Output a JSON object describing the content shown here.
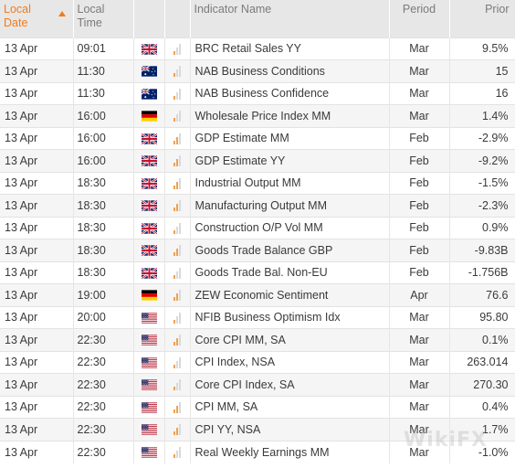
{
  "header": {
    "local_date": "Local Date",
    "local_time": "Local Time",
    "indicator_name": "Indicator Name",
    "period": "Period",
    "prior": "Prior"
  },
  "colors": {
    "accent": "#f07c1c",
    "importance": "#f0a050"
  },
  "rows": [
    {
      "date": "13 Apr",
      "time": "09:01",
      "approx": "",
      "flag": "uk-flag-icon",
      "importance": 1,
      "name": "BRC Retail Sales YY",
      "period": "Mar",
      "prior": "9.5%"
    },
    {
      "date": "13 Apr",
      "time": "11:30",
      "approx": "",
      "flag": "australia-flag-icon",
      "importance": 1,
      "name": "NAB Business Conditions",
      "period": "Mar",
      "prior": "15"
    },
    {
      "date": "13 Apr",
      "time": "11:30",
      "approx": "",
      "flag": "australia-flag-icon",
      "importance": 1,
      "name": "NAB Business Confidence",
      "period": "Mar",
      "prior": "16"
    },
    {
      "date": "13 Apr",
      "time": "16:00",
      "approx": "≈",
      "flag": "germany-flag-icon",
      "importance": 1,
      "name": "Wholesale Price Index MM",
      "period": "Mar",
      "prior": "1.4%"
    },
    {
      "date": "13 Apr",
      "time": "16:00",
      "approx": "",
      "flag": "uk-flag-icon",
      "importance": 2,
      "name": "GDP Estimate MM",
      "period": "Feb",
      "prior": "-2.9%"
    },
    {
      "date": "13 Apr",
      "time": "16:00",
      "approx": "",
      "flag": "uk-flag-icon",
      "importance": 2,
      "name": "GDP Estimate YY",
      "period": "Feb",
      "prior": "-9.2%"
    },
    {
      "date": "13 Apr",
      "time": "18:30",
      "approx": "",
      "flag": "uk-flag-icon",
      "importance": 2,
      "name": "Industrial Output MM",
      "period": "Feb",
      "prior": "-1.5%"
    },
    {
      "date": "13 Apr",
      "time": "18:30",
      "approx": "",
      "flag": "uk-flag-icon",
      "importance": 2,
      "name": "Manufacturing Output MM",
      "period": "Feb",
      "prior": "-2.3%"
    },
    {
      "date": "13 Apr",
      "time": "18:30",
      "approx": "",
      "flag": "uk-flag-icon",
      "importance": 1,
      "name": "Construction O/P Vol MM",
      "period": "Feb",
      "prior": "0.9%"
    },
    {
      "date": "13 Apr",
      "time": "18:30",
      "approx": "",
      "flag": "uk-flag-icon",
      "importance": 2,
      "name": "Goods Trade Balance GBP",
      "period": "Feb",
      "prior": "-9.83B"
    },
    {
      "date": "13 Apr",
      "time": "18:30",
      "approx": "",
      "flag": "uk-flag-icon",
      "importance": 1,
      "name": "Goods Trade Bal. Non-EU",
      "period": "Feb",
      "prior": "-1.756B"
    },
    {
      "date": "13 Apr",
      "time": "19:00",
      "approx": "",
      "flag": "germany-flag-icon",
      "importance": 2,
      "name": "ZEW Economic Sentiment",
      "period": "Apr",
      "prior": "76.6"
    },
    {
      "date": "13 Apr",
      "time": "20:00",
      "approx": "",
      "flag": "usa-flag-icon",
      "importance": 1,
      "name": "NFIB Business Optimism Idx",
      "period": "Mar",
      "prior": "95.80"
    },
    {
      "date": "13 Apr",
      "time": "22:30",
      "approx": "",
      "flag": "usa-flag-icon",
      "importance": 2,
      "name": "Core CPI MM, SA",
      "period": "Mar",
      "prior": "0.1%"
    },
    {
      "date": "13 Apr",
      "time": "22:30",
      "approx": "",
      "flag": "usa-flag-icon",
      "importance": 1,
      "name": "CPI Index, NSA",
      "period": "Mar",
      "prior": "263.014"
    },
    {
      "date": "13 Apr",
      "time": "22:30",
      "approx": "",
      "flag": "usa-flag-icon",
      "importance": 1,
      "name": "Core CPI Index, SA",
      "period": "Mar",
      "prior": "270.30"
    },
    {
      "date": "13 Apr",
      "time": "22:30",
      "approx": "",
      "flag": "usa-flag-icon",
      "importance": 2,
      "name": "CPI MM, SA",
      "period": "Mar",
      "prior": "0.4%"
    },
    {
      "date": "13 Apr",
      "time": "22:30",
      "approx": "",
      "flag": "usa-flag-icon",
      "importance": 2,
      "name": "CPI YY, NSA",
      "period": "Mar",
      "prior": "1.7%"
    },
    {
      "date": "13 Apr",
      "time": "22:30",
      "approx": "",
      "flag": "usa-flag-icon",
      "importance": 1,
      "name": "Real Weekly Earnings MM",
      "period": "Mar",
      "prior": "-1.0%"
    }
  ],
  "watermark": "WikiFX"
}
